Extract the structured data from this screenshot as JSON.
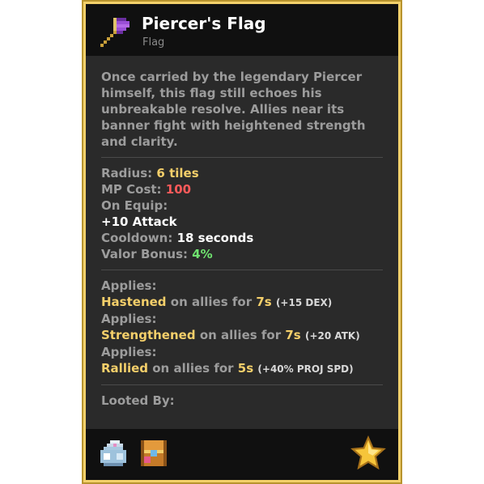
{
  "item": {
    "name": "Piercer's Flag",
    "type": "Flag",
    "description": "Once carried by the legendary Piercer himself, this flag still echoes his unbreakable resolve. Allies near its banner fight with heightened strength and clarity."
  },
  "stats": {
    "radius_label": "Radius:",
    "radius_value": "6 tiles",
    "mp_label": "MP Cost:",
    "mp_value": "100",
    "on_equip_label": "On Equip:",
    "on_equip_bonus": "+10 Attack",
    "cooldown_label": "Cooldown:",
    "cooldown_value": "18 seconds",
    "valor_label": "Valor Bonus:",
    "valor_value": "4%"
  },
  "effects": [
    {
      "applies_label": "Applies:",
      "effect": "Hastened",
      "target_text": "on allies for",
      "duration": "7s",
      "detail": "(+15 DEX)"
    },
    {
      "applies_label": "Applies:",
      "effect": "Strengthened",
      "target_text": "on allies for",
      "duration": "7s",
      "detail": "(+20 ATK)"
    },
    {
      "applies_label": "Applies:",
      "effect": "Rallied",
      "target_text": "on allies for",
      "duration": "5s",
      "detail": "(+40% PROJ SPD)"
    }
  ],
  "looted_by_label": "Looted By:",
  "footer_icons": [
    "loot-bag-icon",
    "treasure-chest-icon",
    "star-icon"
  ],
  "colors": {
    "frame": "#f2d06a",
    "gold_text": "#f4cf6a",
    "mp_red": "#ff5a5a",
    "valor_green": "#6fe36f",
    "item_purple": "#9a4fd6"
  }
}
